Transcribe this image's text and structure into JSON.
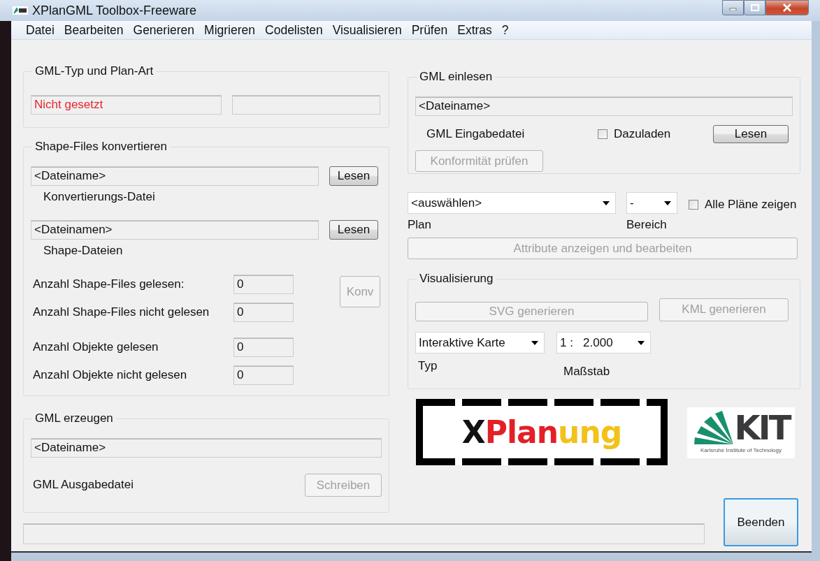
{
  "window": {
    "title": "XPlanGML Toolbox-Freeware"
  },
  "menu": [
    "Datei",
    "Bearbeiten",
    "Generieren",
    "Migrieren",
    "Codelisten",
    "Visualisieren",
    "Prüfen",
    "Extras",
    "?"
  ],
  "gml_type": {
    "title": "GML-Typ und Plan-Art",
    "status": {
      "value": "Nicht gesetzt",
      "error": true
    }
  },
  "shape_files": {
    "title": "Shape-Files konvertieren",
    "files": [
      {
        "value": "<Dateiname>",
        "label": "Konvertierungs-Datei",
        "button": {
          "label": "Lesen",
          "disabled": false
        }
      },
      {
        "value": "<Dateinamen>",
        "label": "Shape-Dateien",
        "button": {
          "label": "Lesen",
          "disabled": false
        }
      }
    ],
    "counts": [
      {
        "label": "Anzahl Shape-Files gelesen:",
        "value": "0"
      },
      {
        "label": "Anzahl Shape-Files nicht gelesen",
        "value": "0"
      },
      {
        "label": "Anzahl Objekte gelesen",
        "value": "0"
      },
      {
        "label": "Anzahl Objekte nicht gelesen",
        "value": "0"
      }
    ],
    "convert_button": {
      "label": "Konv",
      "disabled": true
    }
  },
  "gml_output": {
    "title": "GML erzeugen",
    "value": "<Dateiname>",
    "label": "GML Ausgabedatei",
    "button": {
      "label": "Schreiben",
      "disabled": true
    }
  },
  "gml_input": {
    "title": "GML einlesen",
    "value": "<Dateiname>",
    "label": "GML Eingabedatei",
    "append": {
      "label": "Dazuladen",
      "checked": false
    },
    "read_button": {
      "label": "Lesen",
      "disabled": false
    },
    "check_button": {
      "label": "Konformität prüfen",
      "disabled": true
    }
  },
  "plan": {
    "value": "<auswählen>",
    "label": "Plan"
  },
  "area": {
    "value": "-",
    "label": "Bereich"
  },
  "show_all": {
    "label": "Alle Pläne zeigen",
    "checked": false
  },
  "attributes_button": {
    "label": "Attribute anzeigen und bearbeiten",
    "disabled": true
  },
  "visualization": {
    "title": "Visualisierung",
    "buttons": [
      {
        "label": "SVG generieren",
        "disabled": true
      },
      {
        "label": "KML generieren",
        "disabled": true
      }
    ],
    "type": {
      "value": "Interaktive Karte",
      "label": "Typ"
    },
    "scale": {
      "value": "1 :   2.000",
      "label": "Maßstab"
    }
  },
  "logos": {
    "xplanung": [
      {
        "text": "X",
        "color": "#111111"
      },
      {
        "text": "Plan",
        "color": "#e32028"
      },
      {
        "text": "ung",
        "color": "#f2c21b"
      }
    ],
    "kit": {
      "mark": "KIT",
      "subtitle": "Karlsruhe Institute of Technology"
    }
  },
  "exit_button": {
    "label": "Beenden",
    "disabled": false
  }
}
